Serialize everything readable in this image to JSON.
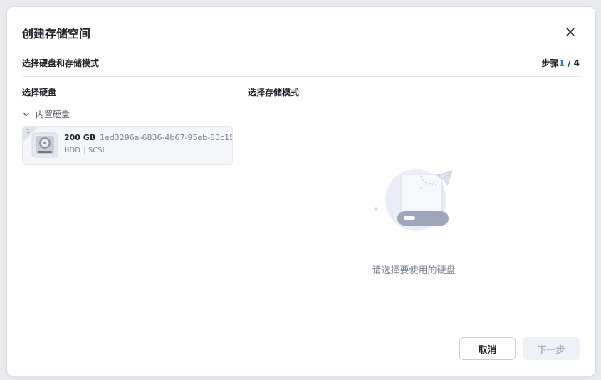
{
  "dialog": {
    "title": "创建存储空间",
    "step_title": "选择硬盘和存储模式",
    "step_label": "步骤",
    "step_current": "1",
    "step_separator": " / ",
    "step_total": "4"
  },
  "left": {
    "title": "选择硬盘",
    "group_label": "内置硬盘",
    "disks": [
      {
        "index": "1",
        "size": "200 GB",
        "id": "1ed3296a-6836-4b67-95eb-83c15...",
        "type": "HDD",
        "interface": "SCSI"
      }
    ]
  },
  "right": {
    "title": "选择存储模式",
    "empty_text": "请选择要使用的硬盘"
  },
  "footer": {
    "cancel_label": "取消",
    "next_label": "下一步"
  },
  "colors": {
    "accent": "#2f7bf5",
    "text_primary": "#1f2329",
    "text_muted": "#7f8898",
    "disabled_bg": "#eef2f7",
    "disabled_text": "#a6b1c2"
  },
  "icons": {
    "close": "close-icon",
    "expand": "chevron-down-icon",
    "disk": "hard-disk-icon",
    "empty": "empty-disk-illustration"
  }
}
